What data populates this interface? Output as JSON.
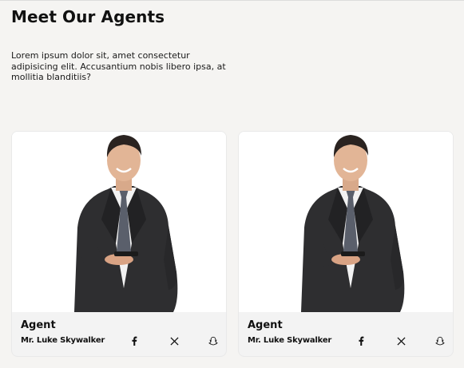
{
  "section": {
    "title": "Meet Our Agents",
    "intro": "Lorem ipsum dolor sit, amet consectetur adipisicing elit. Accusantium nobis libero ipsa, at mollitia blanditiis?"
  },
  "agents": [
    {
      "role": "Agent",
      "name": "Mr. Luke Skywalker",
      "socials": [
        "facebook-icon",
        "x-icon",
        "snapchat-icon"
      ]
    },
    {
      "role": "Agent",
      "name": "Mr. Luke Skywalker",
      "socials": [
        "facebook-icon",
        "x-icon",
        "snapchat-icon"
      ]
    }
  ],
  "colors": {
    "background": "#f5f4f2",
    "card": "#f3f3f3",
    "suit": "#2e2e30",
    "tie": "#5a5f6b"
  }
}
